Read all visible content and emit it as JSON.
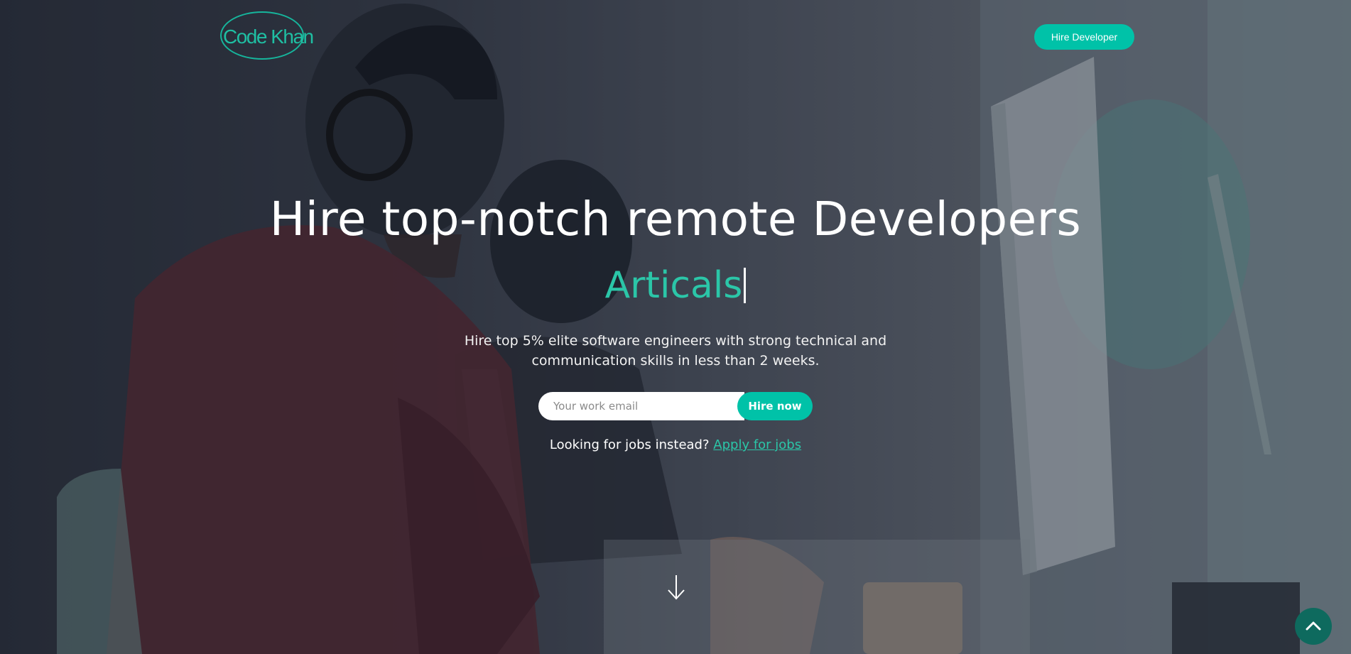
{
  "brand": {
    "logo_text": "Code Khan",
    "accent_color": "#00c2a8",
    "link_color": "#2bc6a8"
  },
  "nav": {
    "cta_label": "Hire Developer"
  },
  "hero": {
    "headline": "Hire top-notch remote Developers",
    "typed_word": "Articals",
    "subtext": "Hire top 5% elite software engineers with strong technical and communication skills in less than 2 weeks.",
    "email_placeholder": "Your work email",
    "submit_label": "Hire now",
    "jobs_prompt": "Looking for jobs instead?",
    "jobs_link_label": "Apply for jobs"
  },
  "icons": {
    "scroll_down": "arrow-down-icon",
    "back_to_top": "chevron-up-icon"
  }
}
